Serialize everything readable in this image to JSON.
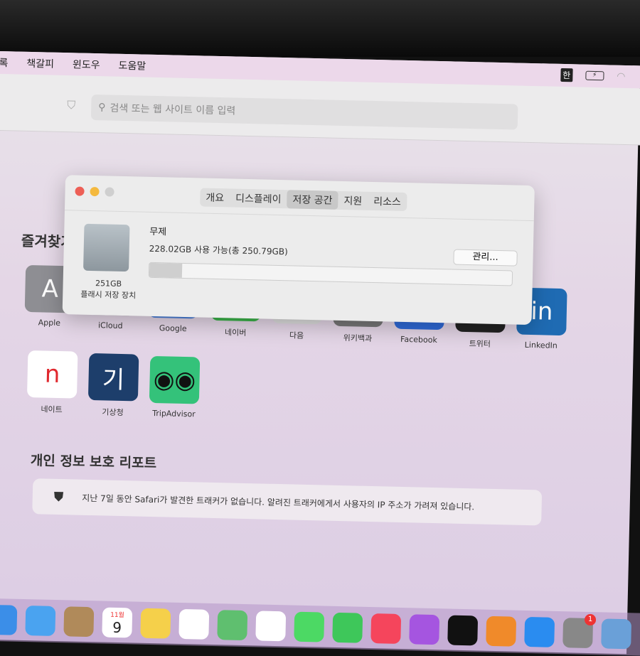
{
  "menubar": {
    "items": [
      "기록",
      "책갈피",
      "윈도우",
      "도움말"
    ],
    "input_source": "한"
  },
  "toolbar": {
    "search_placeholder": "검색 또는 웹 사이트 이름 입력"
  },
  "favorites": {
    "title": "즐겨찾기",
    "items": [
      {
        "label": "Apple",
        "glyph": "A",
        "color": "#8e8e93"
      },
      {
        "label": "iCloud",
        "glyph": "",
        "color": "#8e8e93"
      },
      {
        "label": "Google",
        "glyph": "",
        "color": "#4a7fd8"
      },
      {
        "label": "네이버",
        "glyph": "",
        "color": "#3bb34a"
      },
      {
        "label": "다음",
        "glyph": "",
        "color": "#dddddd"
      },
      {
        "label": "위키백과",
        "glyph": "",
        "color": "#777777"
      },
      {
        "label": "Facebook",
        "glyph": "",
        "color": "#2f6ad8"
      },
      {
        "label": "트위터",
        "glyph": "",
        "color": "#222222"
      },
      {
        "label": "LinkedIn",
        "glyph": "in",
        "color": "#1f6bb3"
      },
      {
        "label": "네이트",
        "glyph": "n",
        "color": "#ffffff"
      },
      {
        "label": "기상청",
        "glyph": "기",
        "color": "#1d3e6b"
      },
      {
        "label": "TripAdvisor",
        "glyph": "◉◉",
        "color": "#34c27a"
      }
    ]
  },
  "dialog": {
    "tabs": [
      "개요",
      "디스플레이",
      "저장 공간",
      "지원",
      "리소스"
    ],
    "selected_tab": "저장 공간",
    "disk_size": "251GB",
    "disk_type": "플래시 저장 장치",
    "volume_name": "무제",
    "availability": "228.02GB 사용 가능(총 250.79GB)",
    "manage_label": "관리...",
    "used_fraction": 0.09
  },
  "privacy": {
    "title": "개인 정보 보호 리포트",
    "message": "지난 7일 동안 Safari가 발견한 트래커가 없습니다. 알려진 트래커에게서 사용자의 IP 주소가 가려져 있습니다."
  },
  "dock": {
    "calendar_month": "11월",
    "calendar_day": "9",
    "notification_badge": "1",
    "apps": [
      {
        "name": "finder",
        "color": "#3b8ee8"
      },
      {
        "name": "mail",
        "color": "#4aa3f0"
      },
      {
        "name": "contacts",
        "color": "#b08a5a"
      },
      {
        "name": "calendar",
        "color": "#ffffff"
      },
      {
        "name": "notes",
        "color": "#f5d04a"
      },
      {
        "name": "reminders",
        "color": "#ffffff"
      },
      {
        "name": "maps",
        "color": "#5fbf6f"
      },
      {
        "name": "photos",
        "color": "#ffffff"
      },
      {
        "name": "messages",
        "color": "#4cd964"
      },
      {
        "name": "facetime",
        "color": "#3ec75a"
      },
      {
        "name": "music",
        "color": "#f5455c"
      },
      {
        "name": "podcasts",
        "color": "#a555e0"
      },
      {
        "name": "tv",
        "color": "#111111"
      },
      {
        "name": "books",
        "color": "#f08a2a"
      },
      {
        "name": "app-store",
        "color": "#2a8cf0"
      },
      {
        "name": "system-preferences",
        "color": "#888888"
      },
      {
        "name": "downloads",
        "color": "#6aa0d8"
      }
    ]
  }
}
